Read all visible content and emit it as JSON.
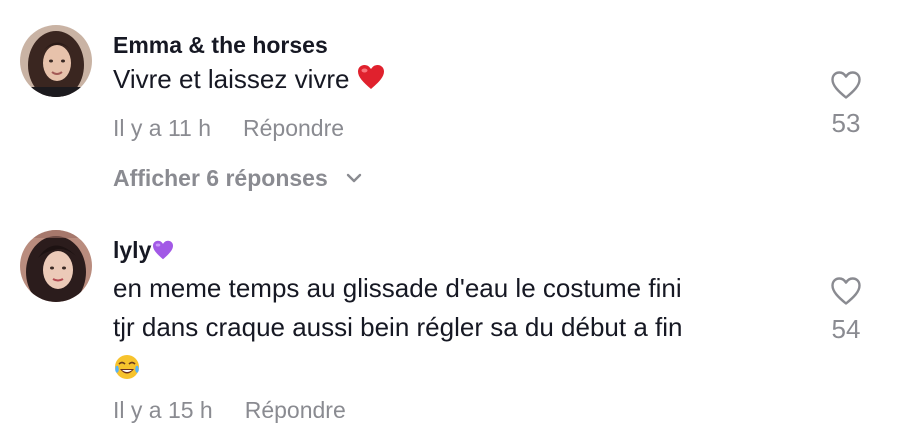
{
  "comments": [
    {
      "username": "Emma & the horses",
      "text": "Vivre et laissez vivre",
      "emoji": "heart-emoji",
      "timestamp": "Il y a 11 h",
      "reply_label": "Répondre",
      "likes": "53",
      "view_replies": "Afficher 6 réponses"
    },
    {
      "username": "lyly",
      "username_emoji": "purple-heart-emoji",
      "text_line1": "en meme temps au glissade d'eau le costume fini",
      "text_line2": "tjr dans craque aussi bein régler sa du début a fin",
      "emoji": "tears-of-joy-emoji",
      "timestamp": "Il y a 15 h",
      "reply_label": "Répondre",
      "likes": "54"
    }
  ],
  "colors": {
    "primary_text": "#161823",
    "secondary_text": "#8a8b91",
    "heart_red": "#e0212d",
    "purple_heart": "#a259e6",
    "background": "#ffffff"
  },
  "icons": [
    "heart-outline-icon",
    "chevron-down-icon"
  ]
}
